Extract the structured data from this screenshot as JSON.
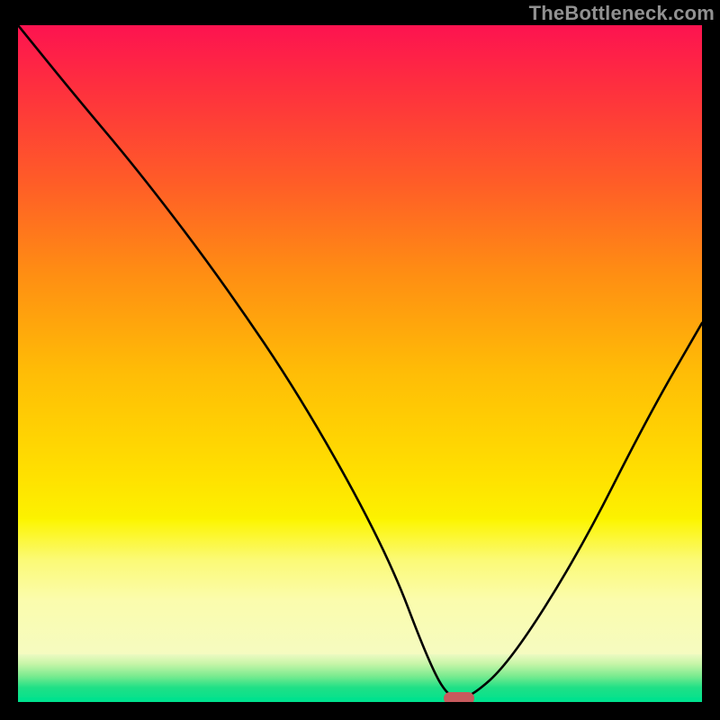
{
  "attribution": "TheBottleneck.com",
  "colors": {
    "frame_bg": "#000000",
    "gradient_top": "#fd1350",
    "gradient_mid": "#ff8d13",
    "gradient_yellow": "#fbf96e",
    "gradient_green": "#00e28e",
    "curve_stroke": "#000000",
    "marker_fill": "#c85a5d",
    "attribution_text": "#919191"
  },
  "chart_data": {
    "type": "line",
    "title": "",
    "xlabel": "",
    "ylabel": "",
    "xlim": [
      0,
      100
    ],
    "ylim": [
      0,
      100
    ],
    "series": [
      {
        "name": "bottleneck-curve",
        "x": [
          0,
          8,
          18,
          30,
          42,
          54,
          60,
          63,
          66,
          72,
          82,
          92,
          100
        ],
        "y": [
          100,
          90,
          78,
          62,
          44,
          22,
          6,
          0.5,
          0.5,
          6,
          22,
          42,
          56
        ]
      }
    ],
    "annotations": [
      {
        "name": "optimal-marker",
        "x": 64.5,
        "y": 0.5
      }
    ],
    "background_gradient_stops": [
      {
        "pct": 0,
        "color": "#fd1350"
      },
      {
        "pct": 32,
        "color": "#ff5d27"
      },
      {
        "pct": 55,
        "color": "#ffbc06"
      },
      {
        "pct": 75,
        "color": "#fbf96e"
      },
      {
        "pct": 93,
        "color": "#f5fbc0"
      },
      {
        "pct": 100,
        "color": "#00e28e"
      }
    ]
  }
}
